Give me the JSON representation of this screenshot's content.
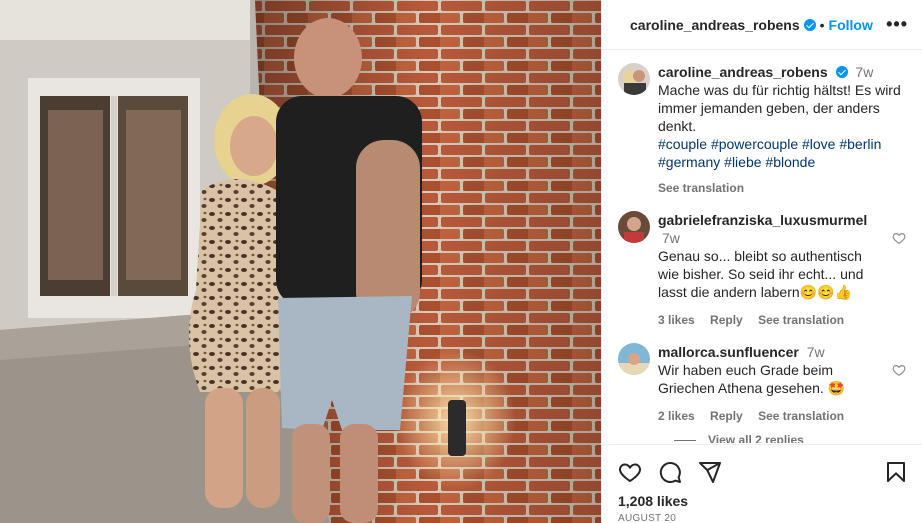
{
  "post": {
    "username": "caroline_andreas_robens",
    "follow_label": "Follow",
    "more_label": "•••",
    "dot": "•"
  },
  "caption": {
    "username": "caroline_andreas_robens",
    "time": "7w",
    "text": "Mache was du für richtig hältst! Es wird immer jemanden geben, der anders denkt.",
    "hashtags": [
      "#couple",
      "#powercouple",
      "#love",
      "#berlin",
      "#germany",
      "#liebe",
      "#blonde"
    ],
    "see_translation": "See translation"
  },
  "comments": [
    {
      "username": "gabrielefranziska_luxusmurmel",
      "time": "7w",
      "text": "Genau so... bleibt so authentisch wie bisher. So seid ihr echt... und lasst die andern labern😊😊👍",
      "likes": "3 likes",
      "reply": "Reply",
      "see_translation": "See translation"
    },
    {
      "username": "mallorca.sunfluencer",
      "time": "7w",
      "text": "Wir haben euch Grade beim Griechen Athena gesehen. 🤩",
      "likes": "2 likes",
      "reply": "Reply",
      "see_translation": "See translation"
    }
  ],
  "view_replies": "View all 2 replies",
  "likes_count": "1,208 likes",
  "post_date": "AUGUST 20",
  "icons": {
    "verified": "verified-badge-icon",
    "like": "heart-icon",
    "comment": "comment-icon",
    "share": "share-icon",
    "save": "bookmark-icon",
    "more": "more-icon"
  },
  "colors": {
    "accent": "#0095f6",
    "text": "#262626",
    "muted": "#737373",
    "hashtag": "#00376b"
  }
}
